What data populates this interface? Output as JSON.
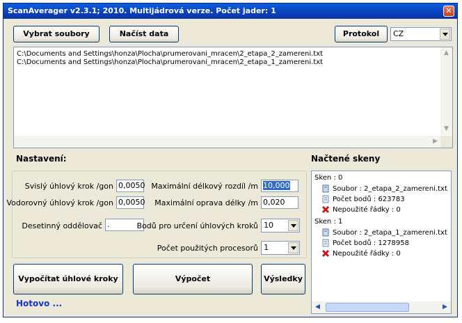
{
  "window": {
    "title": "ScanAverager v2.3.1; 2010. Multijádrová verze. Počet jader: 1"
  },
  "toolbar": {
    "select_files": "Vybrat soubory",
    "load_data": "Načíst data",
    "protocol": "Protokol",
    "language": "CZ"
  },
  "files": [
    "C:\\Documents and Settings\\honza\\Plocha\\prumerovani_mracen\\2_etapa_2_zamereni.txt",
    "C:\\Documents and Settings\\honza\\Plocha\\prumerovani_mracen\\2_etapa_1_zamereni.txt"
  ],
  "settings": {
    "title": "Nastavení:",
    "vertical_step_label": "Svislý úhlový krok /gon",
    "vertical_step_value": "0,0050",
    "horizontal_step_label": "Vodorovný úhlový krok /gon",
    "horizontal_step_value": "0,0050",
    "decimal_sep_label": "Desetinný oddělovač",
    "decimal_sep_value": ".",
    "max_length_diff_label": "Maximální délkový rozdíl /m",
    "max_length_diff_value": "10,000",
    "max_length_corr_label": "Maximální oprava délky /m",
    "max_length_corr_value": "0,020",
    "points_for_steps_label": "Bodů pro určení úhlových kroků",
    "points_for_steps_value": "10",
    "processors_label": "Počet použitých procesorů",
    "processors_value": "1"
  },
  "actions": {
    "compute_steps": "Vypočítat úhlové kroky",
    "compute": "Výpočet",
    "results": "Výsledky"
  },
  "status": "Hotovo ...",
  "scans": {
    "title": "Načtené skeny",
    "items": [
      {
        "header": "Sken : 0",
        "file": "Soubor : 2_etapa_2_zamereni.txt",
        "points": "Počet bodů : 623783",
        "unused": "Nepoužité řádky : 0"
      },
      {
        "header": "Sken : 1",
        "file": "Soubor : 2_etapa_1_zamereni.txt",
        "points": "Počet bodů : 1278958",
        "unused": "Nepoužité řádky : 0"
      }
    ]
  },
  "icons": {
    "close": "close-icon",
    "dropdown": "chevron-down-icon",
    "file": "file-icon",
    "points": "document-icon",
    "unused": "red-x-icon"
  }
}
